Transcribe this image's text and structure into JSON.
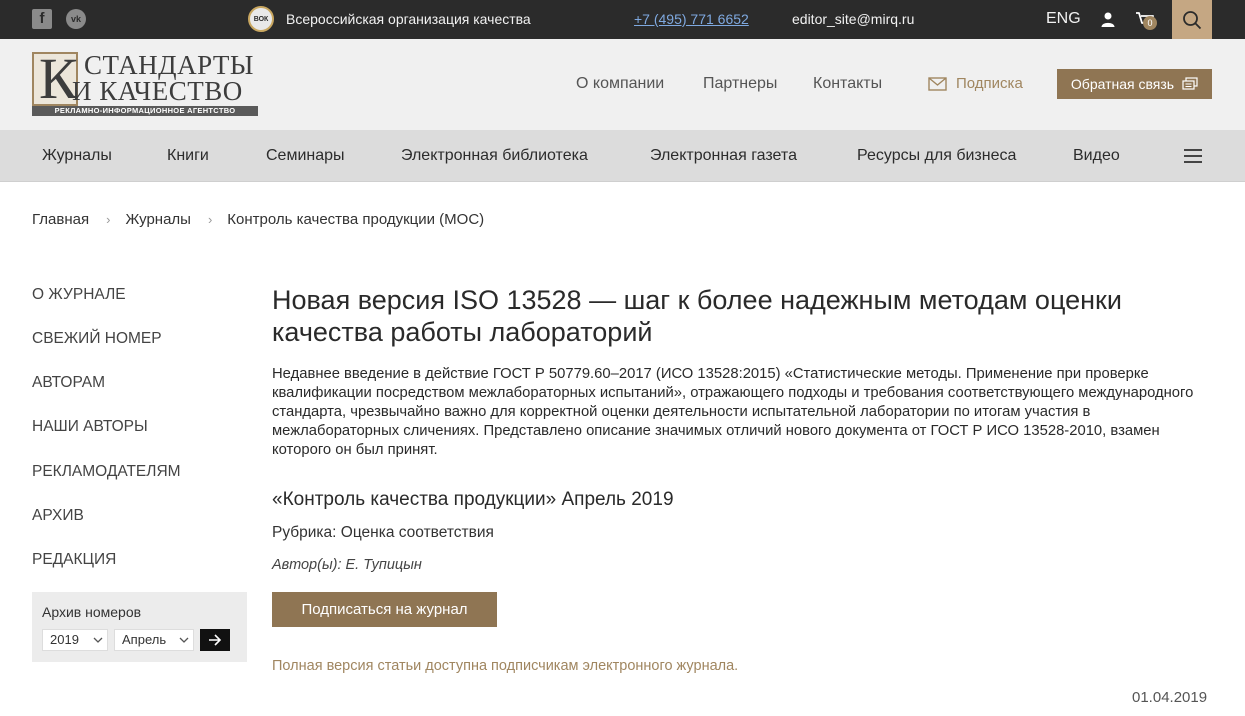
{
  "topbar": {
    "facebook_icon": "f",
    "vk_icon": "vk",
    "org_logo": "ВОК",
    "org_name": "Всероссийская организация качества",
    "phone": "+7 (495) 771 6652",
    "email": "editor_site@mirq.ru",
    "lang": "ENG",
    "cart_count": "0"
  },
  "logo": {
    "letter": "К",
    "line1": "СТАНДАРТЫ",
    "line2": "И КАЧЕСТВО",
    "tagline": "РЕКЛАМНО-ИНФОРМАЦИОННОЕ АГЕНТСТВО"
  },
  "header_nav": {
    "about": "О компании",
    "partners": "Партнеры",
    "contacts": "Контакты",
    "subscribe": "Подписка",
    "feedback": "Обратная связь"
  },
  "main_nav": [
    "Журналы",
    "Книги",
    "Семинары",
    "Электронная библиотека",
    "Электронная газета",
    "Ресурсы для бизнеса",
    "Видео"
  ],
  "breadcrumb": {
    "home": "Главная",
    "journals": "Журналы",
    "current": "Контроль качества продукции (МОС)"
  },
  "sidebar": {
    "items": [
      "О ЖУРНАЛЕ",
      "СВЕЖИЙ НОМЕР",
      "АВТОРАМ",
      "НАШИ АВТОРЫ",
      "РЕКЛАМОДАТЕЛЯМ",
      "АРХИВ",
      "РЕДАКЦИЯ"
    ],
    "archive_title": "Архив номеров",
    "year": "2019",
    "month": "Апрель"
  },
  "article": {
    "title": "Новая версия ISO 13528 — шаг к более надежным методам оценки качества работы лабораторий",
    "lead": "Недавнее введение в действие ГОСТ Р 50779.60–2017 (ИСО 13528:2015) «Статистические методы. Применение при проверке квалификации посредством межлабораторных испытаний», отражающего подходы и требования соответствующего международного стандарта, чрезвычайно важно для корректной оценки деятельности испытательной лаборатории по итогам участия в межлабораторных сличениях. Представлено описание значимых отличий нового документа от ГОСТ Р ИСО 13528-2010, взамен которого он был принят.",
    "issue": "«Контроль качества продукции» Апрель 2019",
    "rubric": "Рубрика: Оценка соответствия",
    "authors": "Автор(ы): Е. Тупицын",
    "subscribe_button": "Подписаться на журнал",
    "access_note": "Полная версия статьи доступна подписчикам электронного журнала.",
    "date": "01.04.2019"
  },
  "colors": {
    "topbar_bg": "#2b2b2b",
    "accent": "#8f7553",
    "accent_light": "#c5a783",
    "header_bg": "#f0f0f0",
    "nav_bg": "#dcdcdc"
  }
}
